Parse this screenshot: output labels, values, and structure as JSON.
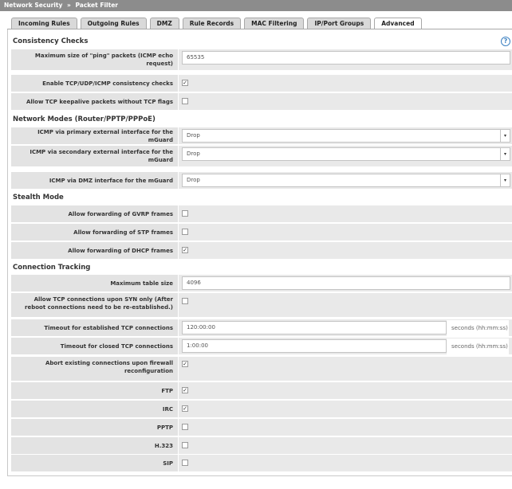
{
  "breadcrumb": {
    "section": "Network Security",
    "separator": "»",
    "page": "Packet Filter"
  },
  "tabs": [
    {
      "label": "Incoming Rules"
    },
    {
      "label": "Outgoing Rules"
    },
    {
      "label": "DMZ"
    },
    {
      "label": "Rule Records"
    },
    {
      "label": "MAC Filtering"
    },
    {
      "label": "IP/Port Groups"
    },
    {
      "label": "Advanced",
      "active": true
    }
  ],
  "help_icon": "?",
  "sections": {
    "consistency": "Consistency Checks",
    "network_modes": "Network Modes (Router/PPTP/PPPoE)",
    "stealth": "Stealth Mode",
    "tracking": "Connection Tracking"
  },
  "consistency": {
    "ping_size_label": "Maximum size of \"ping\" packets (ICMP echo request)",
    "ping_size_value": "65535",
    "enable_checks_label": "Enable TCP/UDP/ICMP consistency checks",
    "enable_checks_checked": true,
    "keepalive_label": "Allow TCP keepalive packets without TCP flags",
    "keepalive_checked": false
  },
  "network_modes": {
    "primary_label": "ICMP via primary external interface for the mGuard",
    "primary_value": "Drop",
    "secondary_label": "ICMP via secondary external interface for the mGuard",
    "secondary_value": "Drop",
    "dmz_label": "ICMP via DMZ interface for the mGuard",
    "dmz_value": "Drop"
  },
  "stealth": {
    "gvrp_label": "Allow forwarding of GVRP frames",
    "gvrp_checked": false,
    "stp_label": "Allow forwarding of STP frames",
    "stp_checked": false,
    "dhcp_label": "Allow forwarding of DHCP frames",
    "dhcp_checked": true
  },
  "tracking": {
    "max_table_label": "Maximum table size",
    "max_table_value": "4096",
    "syn_only_label": "Allow TCP connections upon SYN only (After reboot connections need to be re-established.)",
    "syn_only_checked": false,
    "established_label": "Timeout for established TCP connections",
    "established_value": "120:00:00",
    "established_unit": "seconds (hh:mm:ss)",
    "closed_label": "Timeout for closed TCP connections",
    "closed_value": "1:00:00",
    "closed_unit": "seconds (hh:mm:ss)",
    "abort_label": "Abort existing connections upon firewall reconfiguration",
    "abort_checked": true,
    "ftp_label": "FTP",
    "ftp_checked": true,
    "irc_label": "IRC",
    "irc_checked": true,
    "pptp_label": "PPTP",
    "pptp_checked": false,
    "h323_label": "H.323",
    "h323_checked": false,
    "sip_label": "SIP",
    "sip_checked": false
  },
  "check_glyph": "✓"
}
